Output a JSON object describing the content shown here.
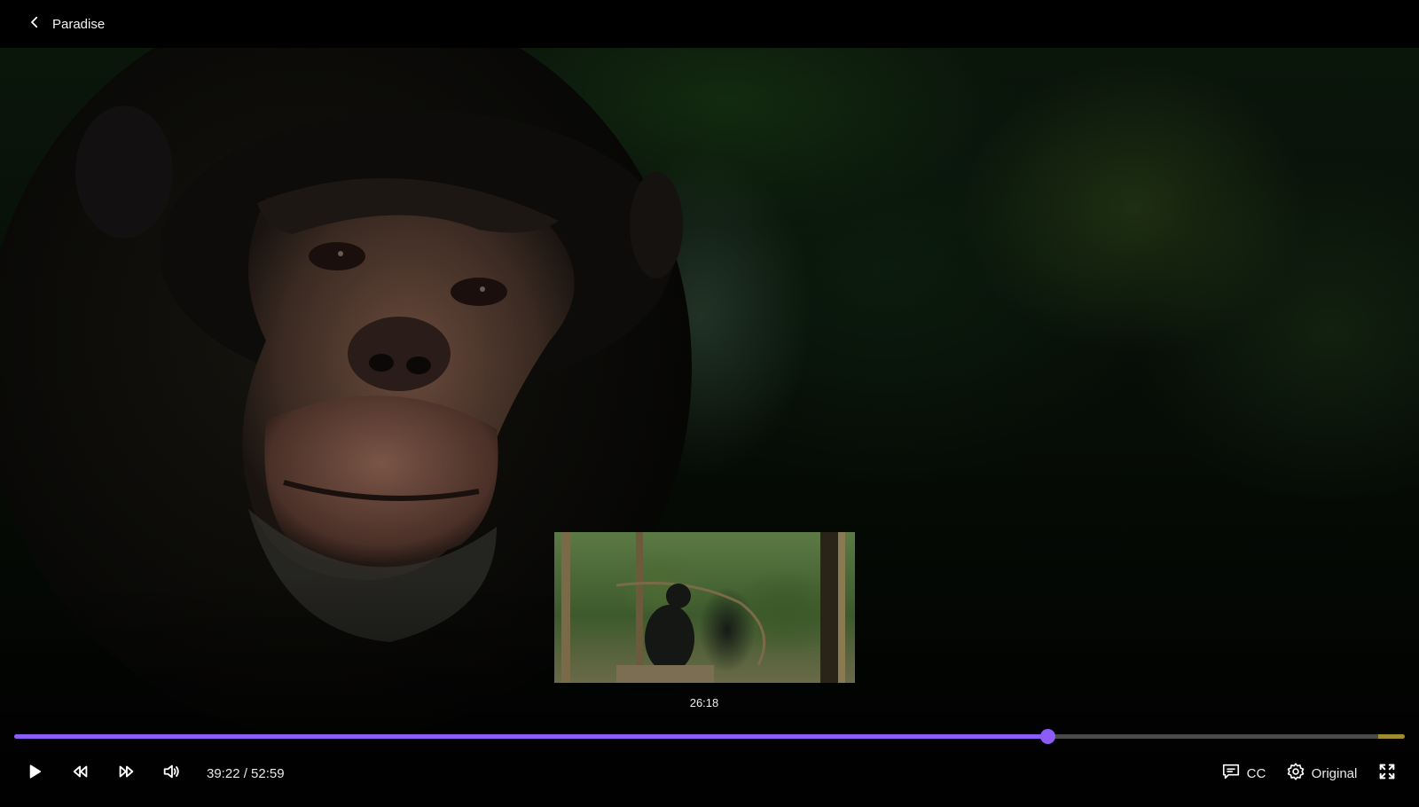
{
  "header": {
    "back_label": "Paradise"
  },
  "preview": {
    "time": "26:18"
  },
  "playback": {
    "current": "39:22",
    "separator": "/",
    "duration": "52:59",
    "time_display": "39:22 / 52:59",
    "hover_fraction": 0.497,
    "progress_fraction": 0.743
  },
  "controls": {
    "cc_label": "CC",
    "quality_label": "Original"
  },
  "colors": {
    "accent": "#8b5cf6",
    "track": "#4a4a4a",
    "marker": "#a18a32"
  },
  "icons": {
    "back": "chevron-left-icon",
    "play": "play-icon",
    "rewind": "rewind-icon",
    "forward": "fast-forward-icon",
    "volume": "volume-icon",
    "cc": "captions-icon",
    "settings": "gear-icon",
    "fullscreen": "fullscreen-icon"
  }
}
